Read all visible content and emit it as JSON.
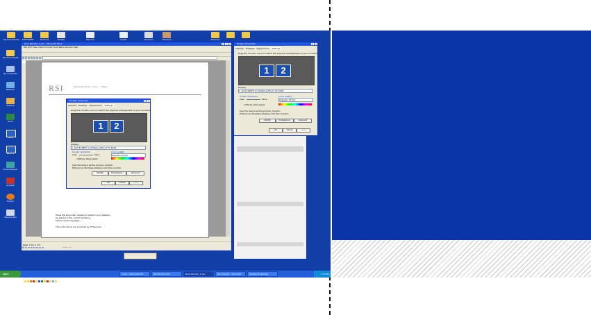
{
  "desktop_icons": [
    {
      "label": "My Documents",
      "color": "#f2c94c"
    },
    {
      "label": "My Computer",
      "color": "#a9c1e8"
    },
    {
      "label": "Network",
      "color": "#6fb0e6"
    },
    {
      "label": "Outlook",
      "color": "#e8b04a"
    },
    {
      "label": "Excel",
      "color": "#2e8b3d"
    },
    {
      "label": "Word",
      "color": "#2d5fc4"
    },
    {
      "label": "Word 2",
      "color": "#2d5fc4"
    },
    {
      "label": "Dreamweaver",
      "color": "#3fa2a2"
    },
    {
      "label": "Acrobat",
      "color": "#c8302c"
    },
    {
      "label": "Firefox",
      "color": "#e07a1e"
    },
    {
      "label": "Recycle Bin",
      "color": "#cfd8e6"
    }
  ],
  "top_icons": [
    "My Documents",
    "SOFTWARE",
    "Shortcut",
    "WinZip",
    "Explorer",
    "Folder",
    "Shortcut",
    "Shortcut",
    "Shortcut"
  ],
  "word_window": {
    "title": "Dual Monitor_1.doc - Microsoft Word",
    "menu": "File  Edit  View  Insert  Format  Tools  Table  Window  Help",
    "letterhead": "RSI",
    "letterhead_sub": "Repetitive Strain Injury ... Office",
    "body_lines": [
      "Move the secondary display to extend your desktop...",
      "be placed in the correct positions.",
      "Follow remaining steps..."
    ],
    "note": "The instructions are provided by IT Services",
    "section_label": "HOW TO",
    "status": "Page 1  Sec 1  1/3"
  },
  "display_dialog": {
    "title": "Display Properties",
    "tabs": [
      "Themes",
      "Desktop",
      "Screen Saver",
      "Appearance",
      "Settings"
    ],
    "instruction": "Drag the monitor icons to match the physical arrangement of your monitors.",
    "monitor_1": "1",
    "monitor_2": "2",
    "display_label": "Display:",
    "display_value": "1. Dell E196FP on NVIDIA GeForce FX 5200",
    "resolution_label": "Screen resolution",
    "resolution_less": "Less",
    "resolution_more": "More",
    "resolution_value": "1280 by 1024 pixels",
    "color_label": "Color quality",
    "color_value": "Highest (32 bit)",
    "primary_check": "Use this device as the primary monitor.",
    "extend_check": "Extend my Windows desktop onto this monitor.",
    "buttons": [
      "Identify",
      "Troubleshoot...",
      "Advanced"
    ],
    "ok": "OK",
    "cancel": "Cancel",
    "apply": "Apply"
  },
  "taskbar": {
    "start": "start",
    "items": [
      "Inbox - Microsoft Out",
      "RSI Monitor Info",
      "Dual Monitor_1.doc",
      "Document2 - Microsoft",
      "Display Properties"
    ],
    "clock": "4:35 PM"
  },
  "colors": {
    "desktop_blue": "#123ea8",
    "title_blue": "#1f57d8",
    "taskbar_blue": "#245edb",
    "start_green": "#3c9a3c",
    "monitor_blue": "#1a4fb0"
  }
}
